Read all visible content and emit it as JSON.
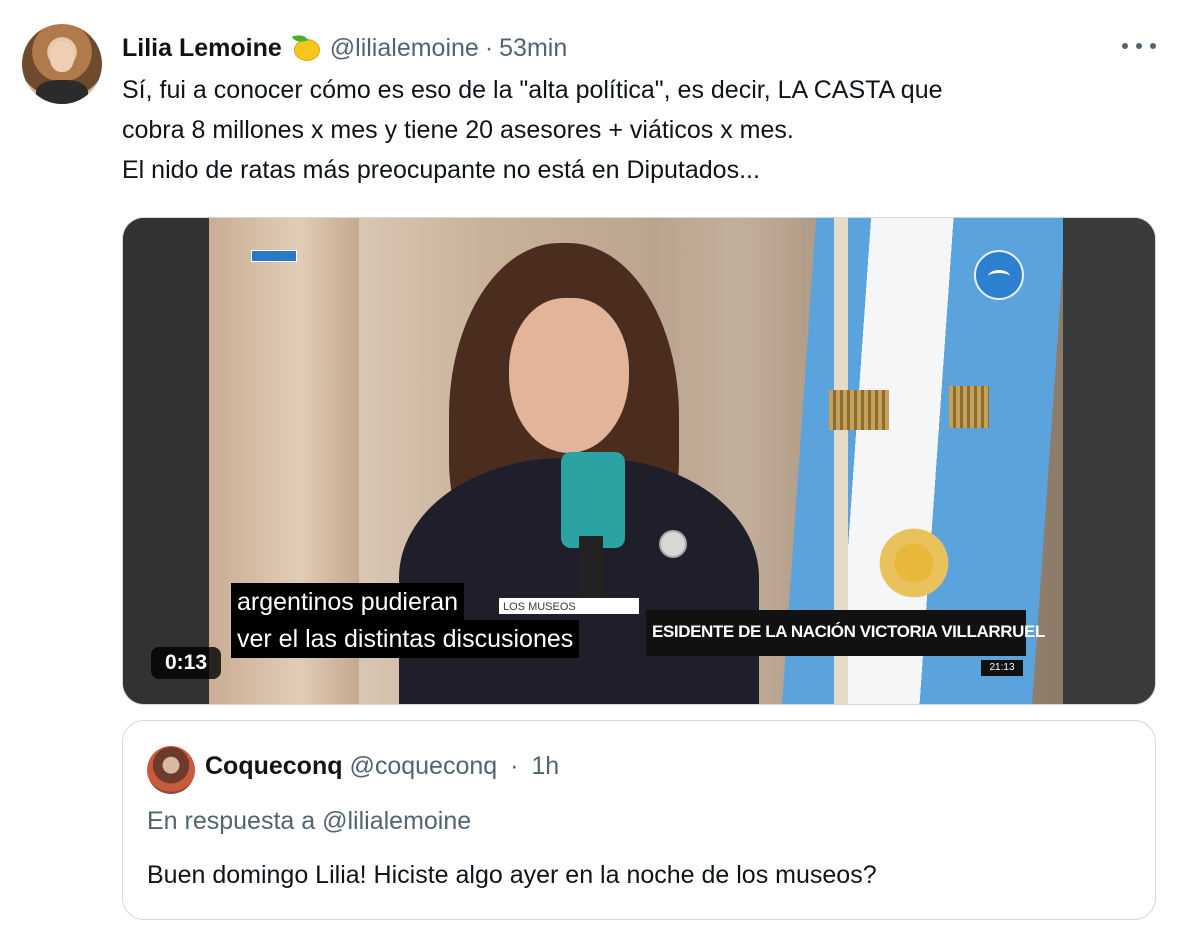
{
  "tweet": {
    "display_name": "Lilia Lemoine",
    "name_emoji": "lemon-icon",
    "handle": "@lilialemoine",
    "separator": "·",
    "time": "53min",
    "text_lines": [
      "Sí, fui a conocer cómo es eso de la \"alta política\", es decir, LA CASTA que",
      "cobra 8 millones x mes y tiene 20 asesores + viáticos x mes.",
      "El nido de ratas más preocupante no está en Diputados..."
    ]
  },
  "video": {
    "subtitle_lines": [
      "argentinos pudieran",
      "ver el las distintas discusiones"
    ],
    "lower_third_small": "LOS MUSEOS",
    "lower_third": "ESIDENTE DE LA NACIÓN VICTORIA VILLARRUEL",
    "clock": "21:13",
    "duration": "0:13"
  },
  "quoted_tweet": {
    "display_name": "Coqueconq",
    "handle": "@coqueconq",
    "separator": "·",
    "time": "1h",
    "reply_to": "En respuesta a @lilialemoine",
    "text": "Buen domingo Lilia! Hiciste algo ayer en la noche de los museos?"
  },
  "colors": {
    "text_primary": "#0f1419",
    "text_secondary": "#536471",
    "border": "#cfd9de",
    "flag_blue": "#5aa3dd"
  }
}
